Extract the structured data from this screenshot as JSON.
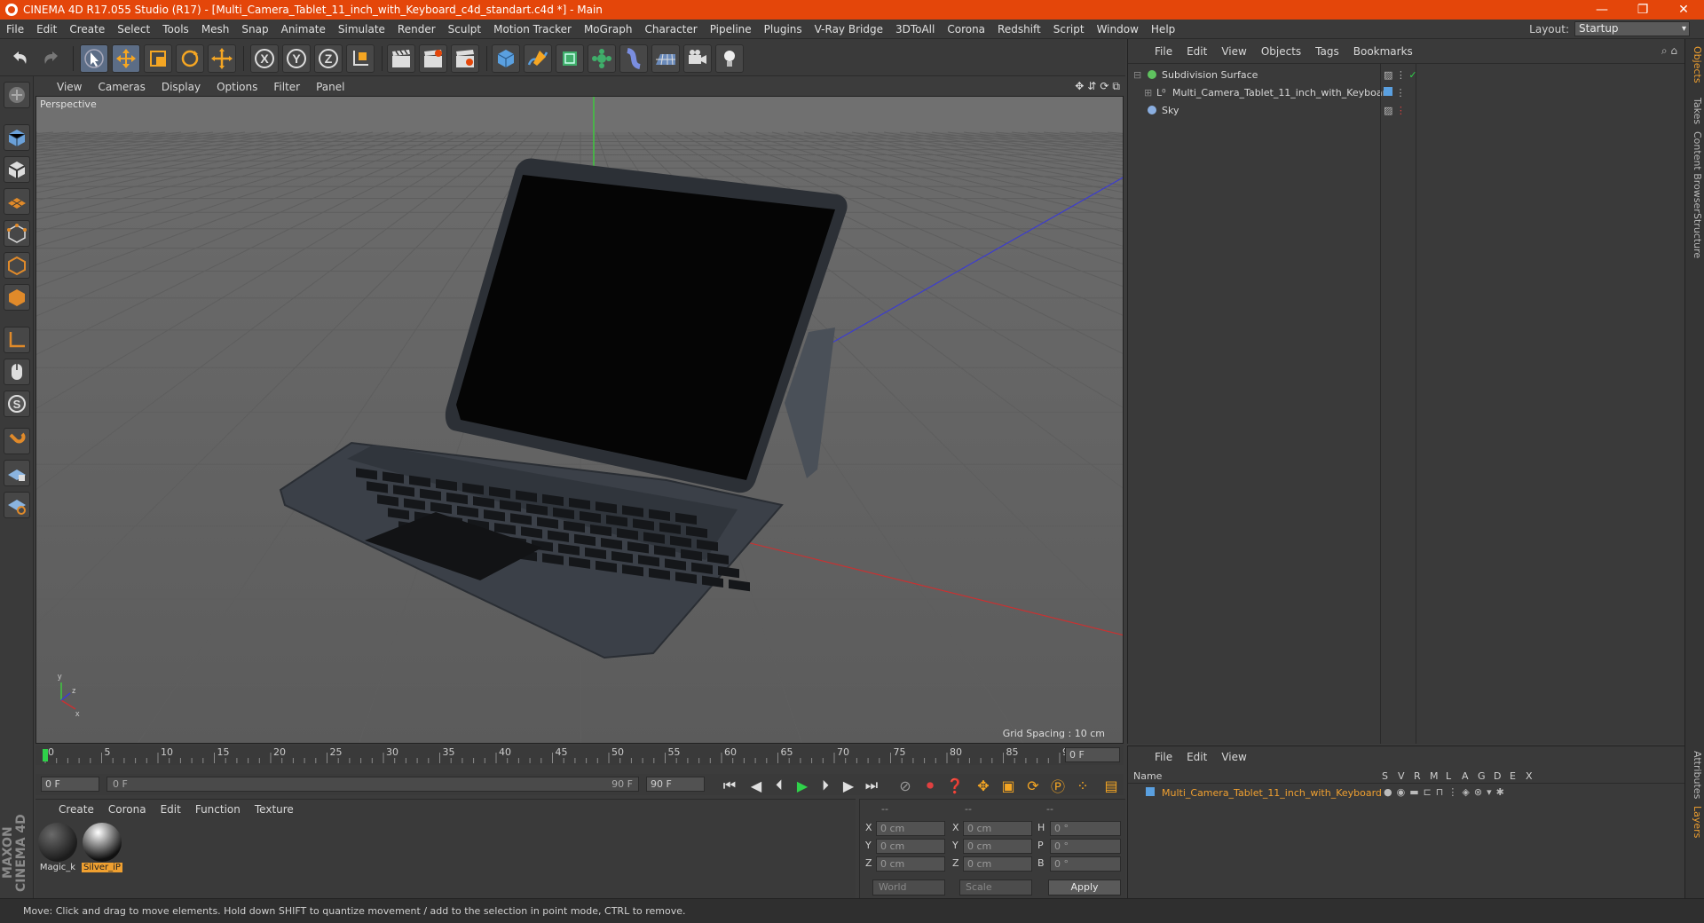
{
  "window": {
    "title": "CINEMA 4D R17.055 Studio (R17) - [Multi_Camera_Tablet_11_inch_with_Keyboard_c4d_standart.c4d *] - Main",
    "controls": [
      "—",
      "❐",
      "✕"
    ]
  },
  "menubar": {
    "items": [
      "File",
      "Edit",
      "Create",
      "Select",
      "Tools",
      "Mesh",
      "Snap",
      "Animate",
      "Simulate",
      "Render",
      "Sculpt",
      "Motion Tracker",
      "MoGraph",
      "Character",
      "Pipeline",
      "Plugins",
      "V-Ray Bridge",
      "3DToAll",
      "Corona",
      "Redshift",
      "Script",
      "Window",
      "Help"
    ],
    "layout_label": "Layout:",
    "layout_value": "Startup"
  },
  "viewport": {
    "menu": [
      "View",
      "Cameras",
      "Display",
      "Options",
      "Filter",
      "Panel"
    ],
    "camera_label": "Perspective",
    "grid_spacing": "Grid Spacing : 10 cm",
    "nav_icons": [
      "move-view-icon",
      "dolly-icon",
      "rotate-view-icon",
      "maximize-icon"
    ]
  },
  "timeline": {
    "ticks": [
      "0",
      "5",
      "10",
      "15",
      "20",
      "25",
      "30",
      "35",
      "40",
      "45",
      "50",
      "55",
      "60",
      "65",
      "70",
      "75",
      "80",
      "85",
      "90"
    ],
    "current_frame": "0 F",
    "start_field": "0 F",
    "range_start": "0 F",
    "range_end": "90 F",
    "end_field": "90 F"
  },
  "materials": {
    "menu": [
      "Create",
      "Corona",
      "Edit",
      "Function",
      "Texture"
    ],
    "items": [
      {
        "label": "Magic_k",
        "selected": false
      },
      {
        "label": "Silver_iP",
        "selected": true
      }
    ]
  },
  "coords": {
    "headers": [
      "--",
      "--",
      "--"
    ],
    "rows": [
      {
        "a": "X",
        "av": "0 cm",
        "b": "X",
        "bv": "0 cm",
        "c": "H",
        "cv": "0 °"
      },
      {
        "a": "Y",
        "av": "0 cm",
        "b": "Y",
        "bv": "0 cm",
        "c": "P",
        "cv": "0 °"
      },
      {
        "a": "Z",
        "av": "0 cm",
        "b": "Z",
        "bv": "0 cm",
        "c": "B",
        "cv": "0 °"
      }
    ],
    "space": "World",
    "mode": "Scale",
    "apply_label": "Apply"
  },
  "objects": {
    "menu": [
      "File",
      "Edit",
      "View",
      "Objects",
      "Tags",
      "Bookmarks"
    ],
    "items": [
      {
        "name": "Subdivision Surface",
        "icon": "subdivision-icon",
        "color": "#5fc25f"
      },
      {
        "name": "Multi_Camera_Tablet_11_inch_with_Keyboard",
        "icon": "null-object-icon",
        "color": "#cfcfcf"
      },
      {
        "name": "Sky",
        "icon": "sky-icon",
        "color": "#8aaee0"
      }
    ]
  },
  "layers": {
    "menu": [
      "File",
      "Edit",
      "View"
    ],
    "header_name": "Name",
    "columns": [
      "S",
      "V",
      "R",
      "M",
      "L",
      "A",
      "G",
      "D",
      "E",
      "X"
    ],
    "row_name": "Multi_Camera_Tablet_11_inch_with_Keyboard",
    "row_color": "#f0a030"
  },
  "right_tabs": [
    "Objects",
    "Takes",
    "Content Browser",
    "Structure"
  ],
  "right_tabs_lower": [
    "Attributes",
    "Layers"
  ],
  "status": "Move: Click and drag to move elements. Hold down SHIFT to quantize movement / add to the selection in point mode, CTRL to remove.",
  "brand": "MAXON CINEMA 4D",
  "colors": {
    "accent": "#e4460a",
    "selection": "#f0a030",
    "x_axis": "#c83232",
    "y_axis": "#3ec83e",
    "z_axis": "#3c3cd0"
  }
}
